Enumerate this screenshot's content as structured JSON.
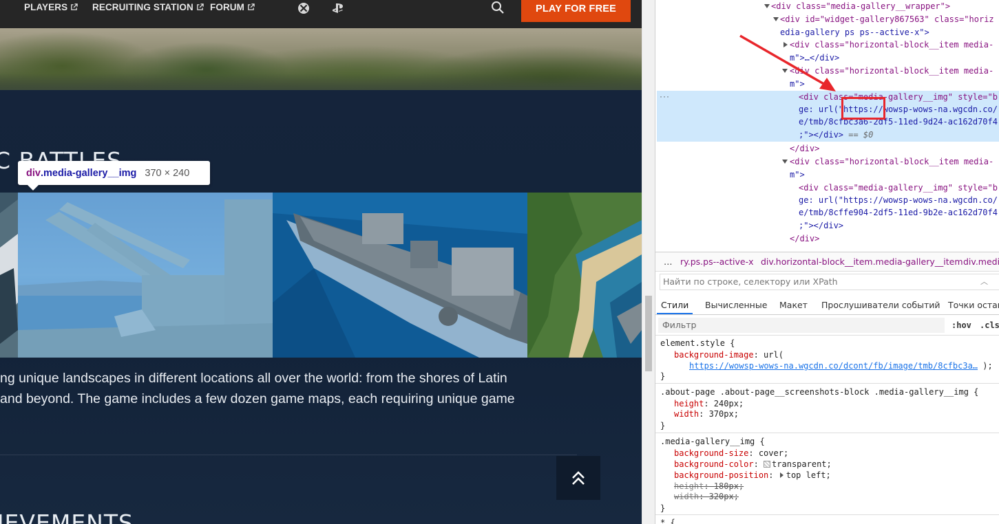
{
  "nav": {
    "players": "PLAYERS",
    "recruiting": "RECRUITING STATION",
    "forum": "FORUM",
    "play_button": "PLAY FOR FREE"
  },
  "page": {
    "section_title": "C BATTLES",
    "section_title_2": "HIEVEMENTS",
    "tooltip_tag": "div",
    "tooltip_class": ".media-gallery__img",
    "tooltip_size": "370 × 240",
    "desc_line1": "ng unique landscapes in different locations all over the world: from the shores of Latin",
    "desc_line2": " and beyond. The game includes a few dozen game maps, each requiring unique game"
  },
  "devtools": {
    "dom": {
      "l0": "<div class=\"media-gallery__wrapper\">",
      "l1a": "<div id=\"widget-gallery867563\" class=\"horiz",
      "l1b": "edia-gallery ps ps--active-x\">",
      "l2a": "<div class=\"horizontal-block__item media-",
      "l2b": "m\">…</div>",
      "l3a": "<div class=\"horizontal-block__item media-",
      "l3b": "m\">",
      "sel_a": "<div class=\"media-gallery__img\" style=\"b",
      "sel_b": "ge: url(\"https://wowsp-wows-na.wgcdn.co/",
      "sel_c": "e/tmb/8cfbc3a6-2df5-11ed-9d24-ac162d70f4",
      "sel_d": ";\"></div>",
      "sel_eq": " == $0",
      "close1": "</div>",
      "l4a": "<div class=\"horizontal-block__item media-",
      "l4b": "m\">",
      "l5a": "<div class=\"media-gallery__img\" style=\"b",
      "l5b": "ge: url(\"https://wowsp-wows-na.wgcdn.co/",
      "l5c": "e/tmb/8cffe904-2df5-11ed-9b2e-ac162d70f4",
      "l5d": ";\"></div>",
      "close2": "</div>"
    },
    "breadcrumbs": [
      "…",
      "ry.ps.ps--active-x",
      "div.horizontal-block__item.media-gallery__item",
      "div.media"
    ],
    "search_placeholder": "Найти по строке, селектору или XPath",
    "tabs": [
      "Стили",
      "Вычисленные",
      "Макет",
      "Прослушиватели событий",
      "Точки останова"
    ],
    "filter_placeholder": "Фильтр",
    "hov": ":hov",
    "cls": ".cls",
    "rules": {
      "r1_sel": "element.style {",
      "r1_prop": "background-image",
      "r1_val": ": url(",
      "r1_url": "https://wowsp-wows-na.wgcdn.co/dcont/fb/image/tmb/8cfbc3a…",
      "r1_end": " );",
      "r2_sel": ".about-page .about-page__screenshots-block .media-gallery__img {",
      "r2_p1": "height",
      "r2_v1": ": 240px;",
      "r2_p2": "width",
      "r2_v2": ": 370px;",
      "r3_sel": ".media-gallery__img {",
      "r3_p1": "background-size",
      "r3_v1": ": cover;",
      "r3_p2": "background-color",
      "r3_v2": "transparent;",
      "r3_p3": "background-position",
      "r3_v3": "top left;",
      "r3_p4": "height",
      "r3_v4": ": 180px;",
      "r3_p5": "width",
      "r3_v5": ": 320px;",
      "close": "}",
      "r4_sel": "* {"
    }
  }
}
